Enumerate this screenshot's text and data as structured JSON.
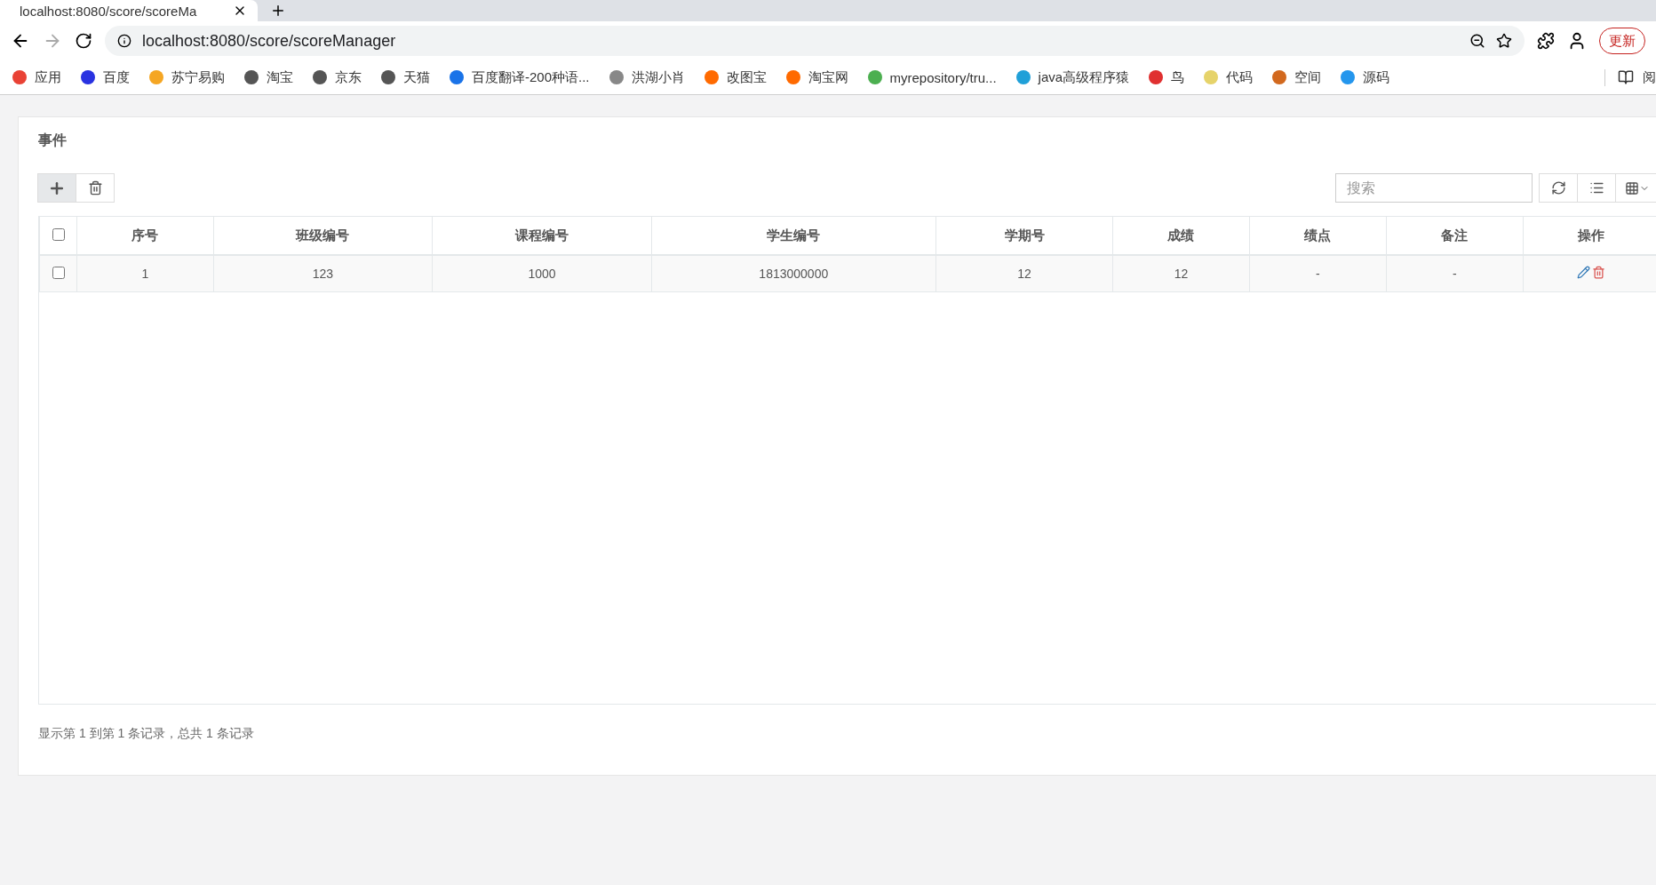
{
  "browser": {
    "tab": {
      "title": "localhost:8080/score/scoreMa",
      "selected": true
    },
    "address": "localhost:8080/score/scoreManager",
    "update_button": "更新",
    "bookmarks": [
      {
        "label": "应用"
      },
      {
        "label": "百度"
      },
      {
        "label": "苏宁易购"
      },
      {
        "label": "淘宝"
      },
      {
        "label": "京东"
      },
      {
        "label": "天猫"
      },
      {
        "label": "百度翻译-200种语..."
      },
      {
        "label": "洪湖小肖"
      },
      {
        "label": "改图宝"
      },
      {
        "label": "淘宝网"
      },
      {
        "label": "myrepository/tru..."
      },
      {
        "label": "java高级程序猿"
      },
      {
        "label": "鸟"
      },
      {
        "label": "代码"
      },
      {
        "label": "空间"
      },
      {
        "label": "源码"
      }
    ],
    "reading_list": "阅"
  },
  "page": {
    "title": "事件",
    "search": {
      "placeholder": "搜索"
    },
    "table": {
      "header_checked": false,
      "columns": [
        "序号",
        "班级编号",
        "课程编号",
        "学生编号",
        "学期号",
        "成绩",
        "绩点",
        "备注",
        "操作"
      ],
      "rows": [
        {
          "checked": false,
          "cells": [
            "1",
            "123",
            "1000",
            "1813000000",
            "12",
            "12",
            "-",
            "-"
          ]
        }
      ]
    },
    "footer": "显示第 1 到第 1 条记录，总共 1 条记录"
  }
}
